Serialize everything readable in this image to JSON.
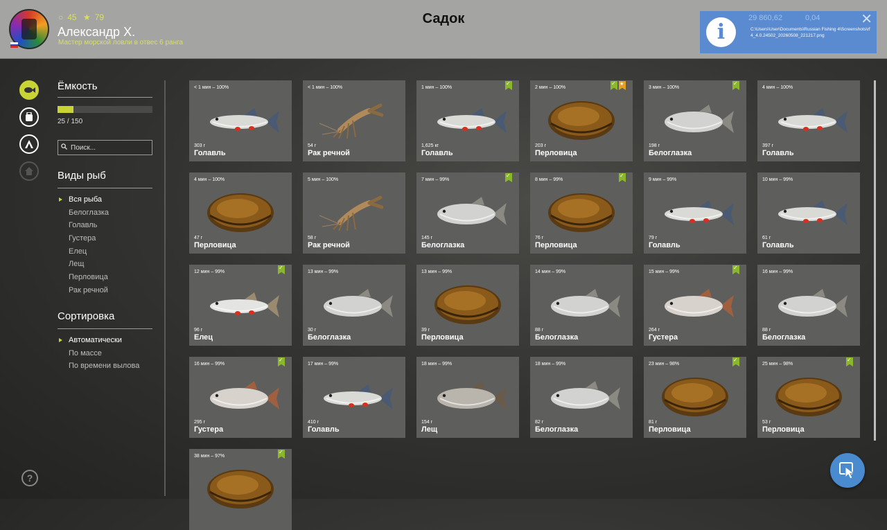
{
  "header": {
    "title": "Садок",
    "user": {
      "name": "Александр Х.",
      "coins": "45",
      "stars": "79",
      "rank": "Мастер морской ловли в отвес 6 ранга"
    },
    "notification": {
      "text": "C:\\Users\\User\\Documents\\Russian Fishing 4\\Screenshots\\rf4_4.0.24502_20260508_221217.png",
      "faint_balance": "29 860,62",
      "faint_gold": "0,04"
    }
  },
  "left_icons": [
    "fish-keepnet-icon",
    "backpack-icon",
    "tent-icon",
    "home-icon"
  ],
  "capacity": {
    "title": "Ёмкость",
    "text": "25 / 150",
    "fill": 0.167
  },
  "search": {
    "placeholder": "Поиск..."
  },
  "species": {
    "title": "Виды рыб",
    "items": [
      "Вся рыба",
      "Белоглазка",
      "Голавль",
      "Густера",
      "Елец",
      "Лещ",
      "Перловица",
      "Рак речной"
    ],
    "selected": 0
  },
  "sort": {
    "title": "Сортировка",
    "items": [
      "Автоматически",
      "По массе",
      "По времени вылова"
    ],
    "selected": 0
  },
  "catches": [
    {
      "time": "< 1 мин – 100%",
      "weight": "303 г",
      "name": "Голавль",
      "kind": "chub",
      "badges": []
    },
    {
      "time": "< 1 мин – 100%",
      "weight": "54 г",
      "name": "Рак речной",
      "kind": "crayfish",
      "badges": []
    },
    {
      "time": "1 мин – 100%",
      "weight": "1,625 кг",
      "name": "Голавль",
      "kind": "chub",
      "badges": [
        "green"
      ]
    },
    {
      "time": "2 мин – 100%",
      "weight": "203 г",
      "name": "Перловица",
      "kind": "mussel",
      "badges": [
        "green",
        "orange"
      ]
    },
    {
      "time": "3 мин – 100%",
      "weight": "198 г",
      "name": "Белоглазка",
      "kind": "bream",
      "badges": [
        "green"
      ]
    },
    {
      "time": "4 мин – 100%",
      "weight": "397 г",
      "name": "Голавль",
      "kind": "chub",
      "badges": []
    },
    {
      "time": "4 мин – 100%",
      "weight": "47 г",
      "name": "Перловица",
      "kind": "mussel",
      "badges": []
    },
    {
      "time": "5 мин – 100%",
      "weight": "58 г",
      "name": "Рак речной",
      "kind": "crayfish",
      "badges": []
    },
    {
      "time": "7 мин – 99%",
      "weight": "145 г",
      "name": "Белоглазка",
      "kind": "bream",
      "badges": [
        "green"
      ]
    },
    {
      "time": "8 мин – 99%",
      "weight": "76 г",
      "name": "Перловица",
      "kind": "mussel",
      "badges": [
        "green"
      ]
    },
    {
      "time": "9 мин – 99%",
      "weight": "79 г",
      "name": "Голавль",
      "kind": "chub",
      "badges": []
    },
    {
      "time": "10 мин – 99%",
      "weight": "61 г",
      "name": "Голавль",
      "kind": "chub",
      "badges": []
    },
    {
      "time": "12 мин – 99%",
      "weight": "96 г",
      "name": "Елец",
      "kind": "dace",
      "badges": [
        "green"
      ]
    },
    {
      "time": "13 мин – 99%",
      "weight": "30 г",
      "name": "Белоглазка",
      "kind": "bream",
      "badges": []
    },
    {
      "time": "13 мин – 99%",
      "weight": "39 г",
      "name": "Перловица",
      "kind": "mussel",
      "badges": []
    },
    {
      "time": "14 мин – 99%",
      "weight": "88 г",
      "name": "Белоглазка",
      "kind": "bream",
      "badges": []
    },
    {
      "time": "15 мин – 99%",
      "weight": "264 г",
      "name": "Густера",
      "kind": "silverbream",
      "badges": [
        "green"
      ]
    },
    {
      "time": "16 мин – 99%",
      "weight": "88 г",
      "name": "Белоглазка",
      "kind": "bream",
      "badges": []
    },
    {
      "time": "16 мин – 99%",
      "weight": "295 г",
      "name": "Густера",
      "kind": "silverbream",
      "badges": [
        "green"
      ]
    },
    {
      "time": "17 мин – 99%",
      "weight": "410 г",
      "name": "Голавль",
      "kind": "chub",
      "badges": []
    },
    {
      "time": "18 мин – 99%",
      "weight": "154 г",
      "name": "Лещ",
      "kind": "bigbream",
      "badges": []
    },
    {
      "time": "18 мин – 99%",
      "weight": "82 г",
      "name": "Белоглазка",
      "kind": "bream",
      "badges": []
    },
    {
      "time": "23 мин – 98%",
      "weight": "81 г",
      "name": "Перловица",
      "kind": "mussel",
      "badges": [
        "green"
      ]
    },
    {
      "time": "25 мин – 98%",
      "weight": "53 г",
      "name": "Перловица",
      "kind": "mussel",
      "badges": [
        "green"
      ]
    },
    {
      "time": "38 мин – 97%",
      "weight": "",
      "name": "",
      "kind": "mussel",
      "badges": [
        "green"
      ]
    }
  ]
}
